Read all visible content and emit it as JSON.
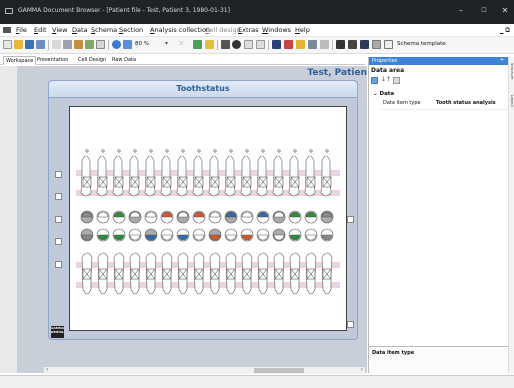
{
  "window": {
    "title": "GAMMA Document Browser - [Patient file - Test, Patient 3, 1980-01-31]",
    "controls": [
      "–",
      "☐",
      "✕"
    ]
  },
  "menu": {
    "items": [
      "File",
      "Edit",
      "View",
      "Data",
      "Schema",
      "Section",
      "Analysis collection",
      "Cell design",
      "Extras",
      "Windows",
      "Help"
    ],
    "mdi_controls": "_ ⧉"
  },
  "toolbar": {
    "zoom": "80 %",
    "schema_template_label": "Schema template"
  },
  "tabs": [
    "Workspace",
    "Presentation",
    "Cell Design",
    "Raw Data"
  ],
  "workspace": {
    "patient_name": "Test, Patien",
    "panel_title": "Toothstatus",
    "logo_text": "GAMMA DENTAL"
  },
  "properties": {
    "title": "Properties",
    "section": "Data area",
    "group": "Data",
    "row_key": "Data item type",
    "row_value": "Tooth status analysis",
    "description_title": "Data item type"
  },
  "side_tabs": [
    "Structure",
    "Layout"
  ],
  "colors": {
    "titlebar": "#1f2226",
    "accent": "#3d84d6",
    "panel_title": "#2b5e9b"
  }
}
